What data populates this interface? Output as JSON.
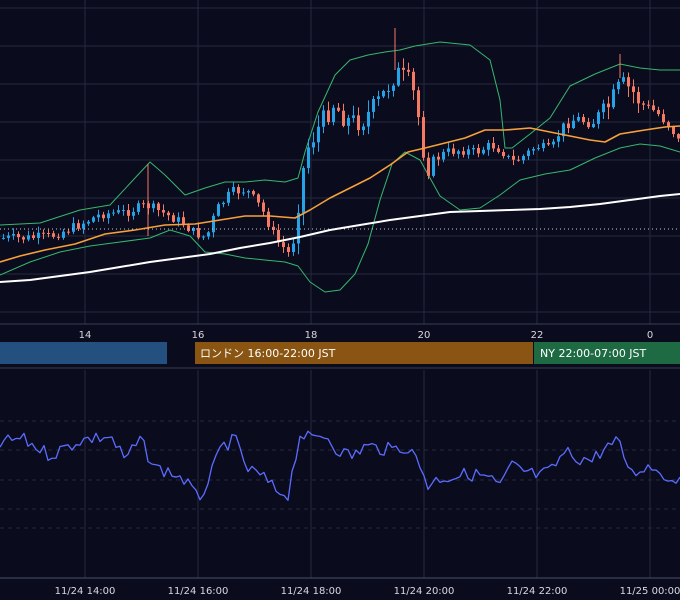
{
  "colors": {
    "background": "#0b0b1e",
    "grid": "#242a3f",
    "candle_up": "#26a2e6",
    "candle_down": "#f47a63",
    "sma_short": "#f7a13a",
    "sma_long": "#ffffff",
    "bollinger": "#35b86b",
    "oscillator": "#5b6cff",
    "session_tokyo": "#24507f",
    "session_london": "#8a5512",
    "session_ny": "#1e6a43"
  },
  "chart_data": {
    "type": "candlestick",
    "price_axis_ticks": [
      "14",
      "16",
      "18",
      "20",
      "22",
      "0"
    ],
    "time_axis_ticks": [
      "11/24 14:00",
      "11/24 16:00",
      "11/24 18:00",
      "11/24 20:00",
      "11/24 22:00",
      "11/25 00:00"
    ],
    "sessions": [
      {
        "name": "tokyo",
        "label": ""
      },
      {
        "name": "london",
        "label": "ロンドン 16:00-22:00 JST"
      },
      {
        "name": "ny",
        "label": "NY 22:00-07:00 JST"
      }
    ],
    "overlays": [
      "sma_short",
      "sma_long",
      "bollinger_bands"
    ],
    "lower_panel": {
      "type": "line",
      "series": "oscillator"
    },
    "grid": true
  }
}
